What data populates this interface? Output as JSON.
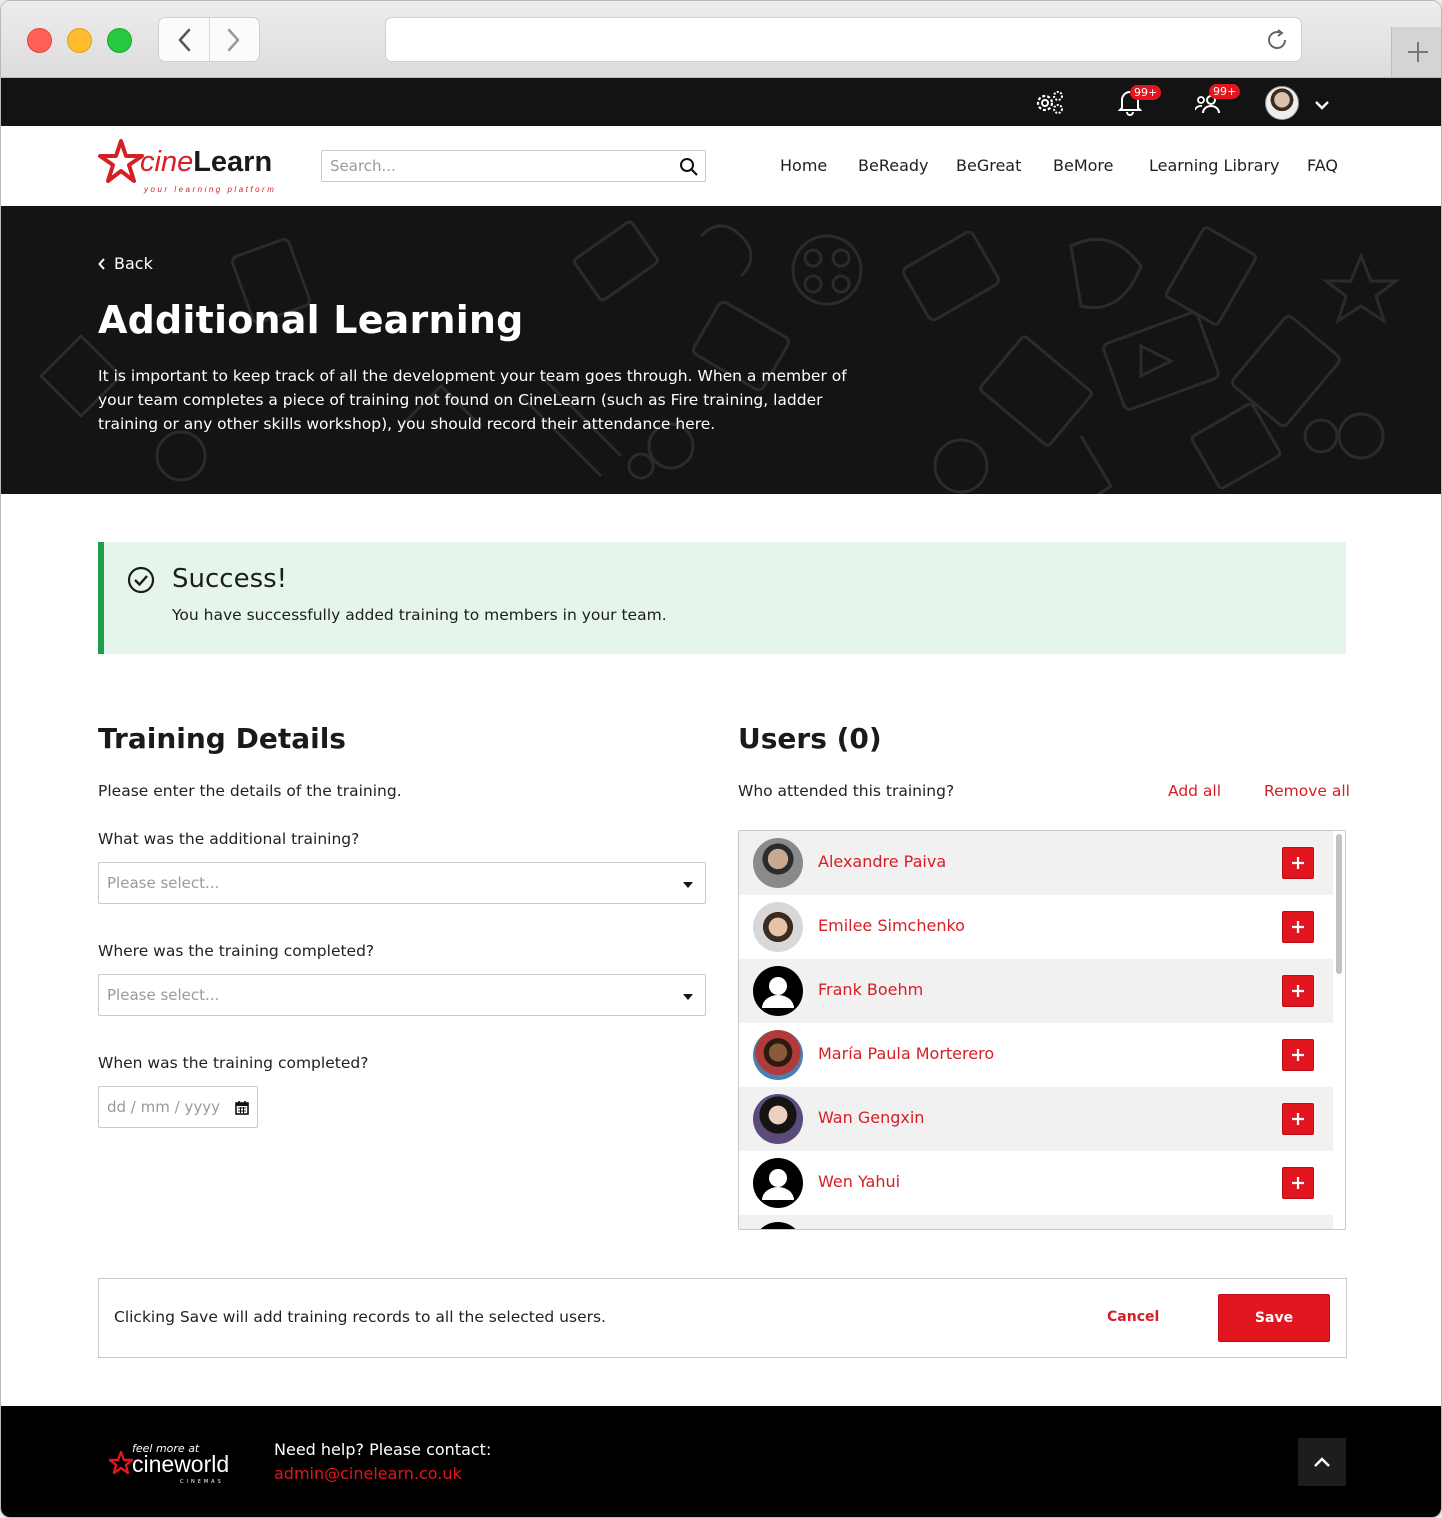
{
  "topbar": {
    "notifications_badge": "99+",
    "team_badge": "99+"
  },
  "header": {
    "logo_cine": "cine",
    "logo_learn": "Learn",
    "logo_tagline": "your learning platform",
    "search_placeholder": "Search...",
    "nav": [
      {
        "label": "Home"
      },
      {
        "label": "BeReady"
      },
      {
        "label": "BeGreat"
      },
      {
        "label": "BeMore"
      },
      {
        "label": "Learning Library"
      },
      {
        "label": "FAQ"
      }
    ]
  },
  "hero": {
    "back_label": "Back",
    "title": "Additional Learning",
    "description": "It is important to keep track of all the development your team goes through. When a member of your team completes a piece of training not found on CineLearn (such as Fire training, ladder training or any other skills workshop), you should record their attendance here."
  },
  "success": {
    "title": "Success!",
    "message": "You have successfully added training to members in your team."
  },
  "training": {
    "heading": "Training Details",
    "intro": "Please enter the details of the training.",
    "q_training": "What was the additional training?",
    "q_location": "Where was the training completed?",
    "q_date": "When was the training completed?",
    "select_placeholder": "Please select...",
    "date_placeholder": "dd / mm / yyyy"
  },
  "users": {
    "heading": "Users (0)",
    "question": "Who attended this training?",
    "add_all": "Add all",
    "remove_all": "Remove all",
    "list": [
      {
        "name": "Alexandre Paiva"
      },
      {
        "name": "Emilee Simchenko"
      },
      {
        "name": "Frank Boehm"
      },
      {
        "name": "María Paula Morterero"
      },
      {
        "name": "Wan Gengxin"
      },
      {
        "name": "Wen Yahui"
      }
    ]
  },
  "actions": {
    "message": "Clicking Save will add training records to all the selected users.",
    "cancel": "Cancel",
    "save": "Save"
  },
  "footer": {
    "logo_small": "feel more at",
    "logo_big": "cineworld",
    "logo_cinemas": "CINEMAS",
    "help": "Need help? Please contact:",
    "email": "admin@cinelearn.co.uk"
  },
  "colors": {
    "brand_red": "#e3161f",
    "success_green": "#1e9e4a",
    "success_bg": "#e6f5ec"
  }
}
